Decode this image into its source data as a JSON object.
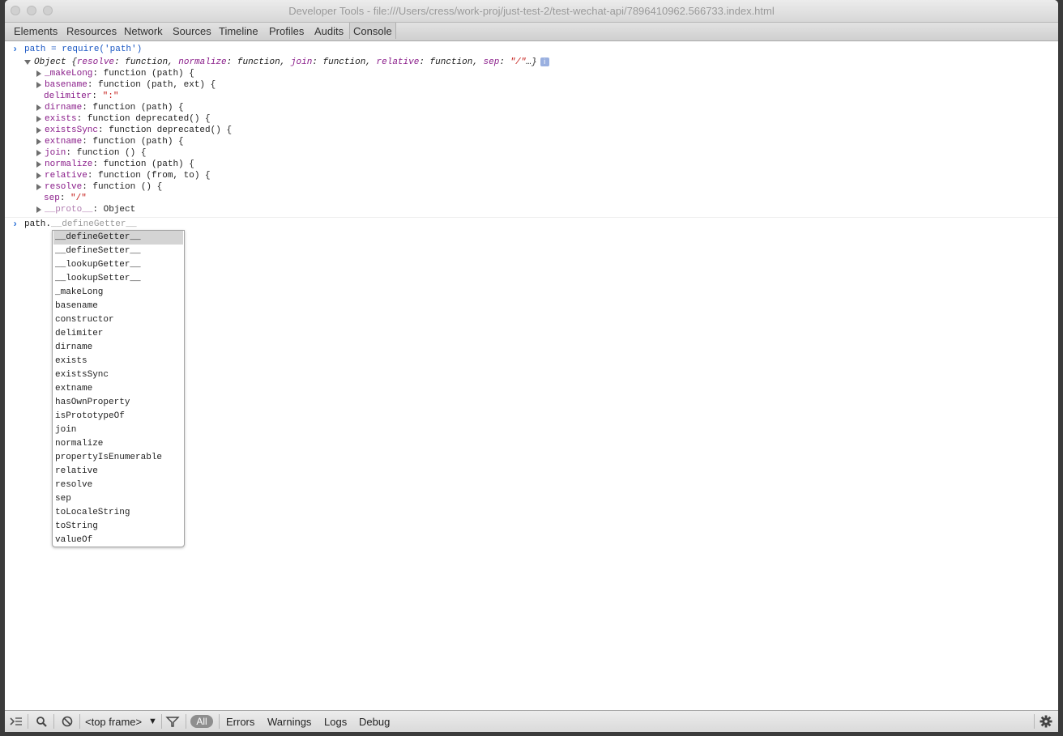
{
  "window": {
    "title": "Developer Tools - file:///Users/cress/work-proj/just-test-2/test-wechat-api/7896410962.566733.index.html"
  },
  "tabs": [
    {
      "label": "Elements"
    },
    {
      "label": "Resources"
    },
    {
      "label": "Network"
    },
    {
      "label": "Sources"
    },
    {
      "label": "Timeline"
    },
    {
      "label": "Profiles"
    },
    {
      "label": "Audits"
    },
    {
      "label": "Console",
      "selected": true
    }
  ],
  "console": {
    "command1": "path = require('path')",
    "object_summary": {
      "label": "Object",
      "open": " {",
      "k1": "resolve",
      "v1": ": function, ",
      "k2": "normalize",
      "v2": ": function, ",
      "k3": "join",
      "v3": ": function, ",
      "k4": "relative",
      "v4": ": function, ",
      "k5": "sep",
      "v5": ": ",
      "sepval": "\"/\"",
      "close": "…}",
      "info": "i"
    },
    "properties": [
      {
        "key": "_makeLong",
        "value": ": function (path) {",
        "expandable": true
      },
      {
        "key": "basename",
        "value": ": function (path, ext) {",
        "expandable": true
      },
      {
        "key": "delimiter",
        "value": ": ",
        "str": "\":\"",
        "expandable": false
      },
      {
        "key": "dirname",
        "value": ": function (path) {",
        "expandable": true
      },
      {
        "key": "exists",
        "value": ": function deprecated() {",
        "expandable": true
      },
      {
        "key": "existsSync",
        "value": ": function deprecated() {",
        "expandable": true
      },
      {
        "key": "extname",
        "value": ": function (path) {",
        "expandable": true
      },
      {
        "key": "join",
        "value": ": function () {",
        "expandable": true
      },
      {
        "key": "normalize",
        "value": ": function (path) {",
        "expandable": true
      },
      {
        "key": "relative",
        "value": ": function (from, to) {",
        "expandable": true
      },
      {
        "key": "resolve",
        "value": ": function () {",
        "expandable": true
      },
      {
        "key": "sep",
        "value": ": ",
        "str": "\"/\"",
        "expandable": false
      },
      {
        "key": "__proto__",
        "value": ": Object",
        "expandable": true,
        "faded": true
      }
    ],
    "input_typed": "path.",
    "input_suggestion": "__defineGetter__",
    "autocomplete": [
      "__defineGetter__",
      "__defineSetter__",
      "__lookupGetter__",
      "__lookupSetter__",
      "_makeLong",
      "basename",
      "constructor",
      "delimiter",
      "dirname",
      "exists",
      "existsSync",
      "extname",
      "hasOwnProperty",
      "isPrototypeOf",
      "join",
      "normalize",
      "propertyIsEnumerable",
      "relative",
      "resolve",
      "sep",
      "toLocaleString",
      "toString",
      "valueOf"
    ],
    "autocomplete_selected_index": 0
  },
  "statusbar": {
    "frame_select": "<top frame>",
    "all_label": "All",
    "errors_label": "Errors",
    "warnings_label": "Warnings",
    "logs_label": "Logs",
    "debug_label": "Debug"
  },
  "icons": {
    "drawer": "show-drawer-icon",
    "search": "search-icon",
    "clear": "clear-console-icon",
    "filter": "filter-icon",
    "settings": "gear-icon"
  }
}
